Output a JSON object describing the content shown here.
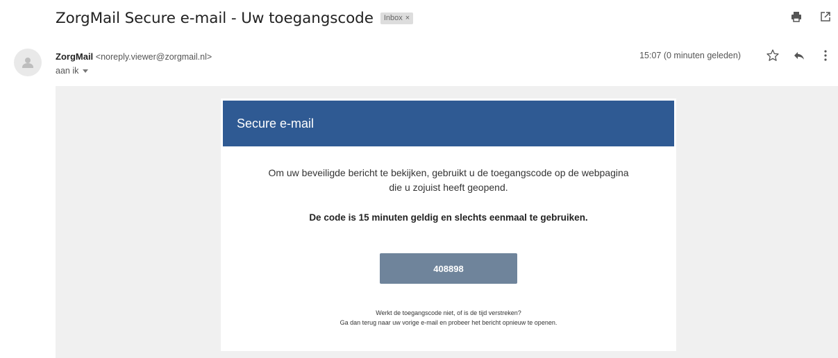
{
  "email": {
    "subject": "ZorgMail Secure e-mail - Uw toegangscode",
    "label": "Inbox",
    "label_close": "×"
  },
  "sender": {
    "name": "ZorgMail",
    "email": "<noreply.viewer@zorgmail.nl>",
    "recipient": "aan ik"
  },
  "meta": {
    "timestamp": "15:07 (0 minuten geleden)"
  },
  "icons": {
    "print": "print-icon",
    "open_new_window": "open-in-new-window-icon",
    "star": "star-icon",
    "reply": "reply-icon",
    "more": "more-vertical-icon",
    "avatar": "person-avatar-icon"
  },
  "message": {
    "header": "Secure e-mail",
    "intro_line1": "Om uw beveiligde bericht te bekijken, gebruikt u de toegangscode op de webpagina",
    "intro_line2": "die u zojuist heeft geopend.",
    "notice": "De code is 15 minuten geldig en slechts eenmaal te gebruiken.",
    "code": "408898",
    "footer_line1": "Werkt de toegangscode niet, of is de tijd verstreken?",
    "footer_line2": "Ga dan terug naar uw vorige e-mail en probeer het bericht opnieuw te openen."
  },
  "colors": {
    "header_blue": "#2f5a93",
    "code_button": "#6f849b",
    "body_background": "#f0f0f0"
  }
}
